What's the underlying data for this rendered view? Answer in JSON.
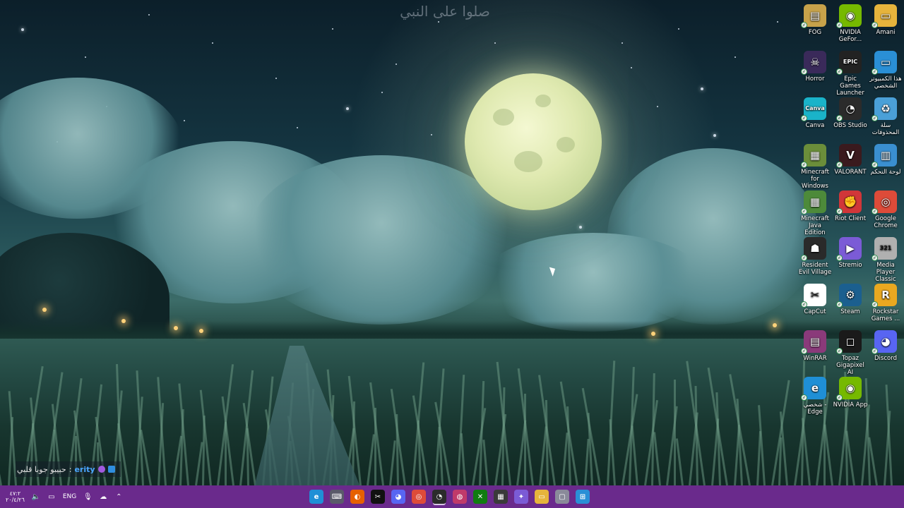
{
  "wallpaper": {
    "watermark_text": "صلوا على النبي",
    "moon_color": "#e6eeb8",
    "sky_color": "#143440"
  },
  "chat_overlay": {
    "username": "erity",
    "separator": ":",
    "message": "حبيبو جوبا قلبي"
  },
  "desktop": {
    "icons": [
      {
        "label": "FOG",
        "icon": "folder-icon",
        "color": "#c7a24a",
        "glyph": "▤"
      },
      {
        "label": "NVIDIA GeFor...",
        "icon": "nvidia-icon",
        "color": "#76b900",
        "glyph": "◉"
      },
      {
        "label": "Amani",
        "icon": "folder-icon",
        "color": "#e6b43c",
        "glyph": "▭"
      },
      {
        "label": "Horror",
        "icon": "ghost-icon",
        "color": "#3a2a5a",
        "glyph": "☠"
      },
      {
        "label": "Epic Games Launcher",
        "icon": "epic-games-icon",
        "color": "#222222",
        "glyph": "EPIC"
      },
      {
        "label": "هذا الكمبيوتر الشخصي",
        "icon": "computer-icon",
        "color": "#2a8fd6",
        "glyph": "▭"
      },
      {
        "label": "Canva",
        "icon": "canva-icon",
        "color": "#1ab3c9",
        "glyph": "Canva"
      },
      {
        "label": "OBS Studio",
        "icon": "obs-icon",
        "color": "#2b2b2b",
        "glyph": "◔"
      },
      {
        "label": "سلة المحذوفات",
        "icon": "recycle-bin-icon",
        "color": "#4aa0d8",
        "glyph": "♻"
      },
      {
        "label": "Minecraft for Windows",
        "icon": "minecraft-icon",
        "color": "#6b8e3a",
        "glyph": "▦"
      },
      {
        "label": "VALORANT",
        "icon": "valorant-icon",
        "color": "#3a1a1e",
        "glyph": "V"
      },
      {
        "label": "لوحة التحكم",
        "icon": "control-panel-icon",
        "color": "#3a8fd0",
        "glyph": "▥"
      },
      {
        "label": "Minecraft Java Edition",
        "icon": "minecraft-java-icon",
        "color": "#4d8a3a",
        "glyph": "▦"
      },
      {
        "label": "Riot Client",
        "icon": "riot-icon",
        "color": "#d13639",
        "glyph": "✊"
      },
      {
        "label": "Google Chrome",
        "icon": "chrome-icon",
        "color": "#dd4b39",
        "glyph": "◎"
      },
      {
        "label": "Resident Evil Village",
        "icon": "resident-evil-icon",
        "color": "#2a2a2a",
        "glyph": "☗"
      },
      {
        "label": "Stremio",
        "icon": "stremio-icon",
        "color": "#7b5bd6",
        "glyph": "▶"
      },
      {
        "label": "Media Player Classic",
        "icon": "media-player-icon",
        "color": "#b0b0b0",
        "glyph": "321"
      },
      {
        "label": "CapCut",
        "icon": "capcut-icon",
        "color": "#ffffff",
        "glyph": "✂"
      },
      {
        "label": "Steam",
        "icon": "steam-icon",
        "color": "#1b5f8f",
        "glyph": "⚙"
      },
      {
        "label": "Rockstar Games ...",
        "icon": "rockstar-icon",
        "color": "#e9a820",
        "glyph": "R"
      },
      {
        "label": "WinRAR",
        "icon": "winrar-icon",
        "color": "#8a3a7a",
        "glyph": "▤"
      },
      {
        "label": "Topaz Gigapixel AI",
        "icon": "topaz-icon",
        "color": "#1a1a1a",
        "glyph": "◻"
      },
      {
        "label": "Discord",
        "icon": "discord-icon",
        "color": "#5865f2",
        "glyph": "◕"
      },
      {
        "label": "شخصي - Edge",
        "icon": "edge-icon",
        "color": "#1f8fd6",
        "glyph": "e"
      },
      {
        "label": "NVIDIA App",
        "icon": "nvidia-app-icon",
        "color": "#76b900",
        "glyph": "◉"
      }
    ]
  },
  "taskbar": {
    "color": "#6a2a8c",
    "tray": {
      "clock_time": "٤٧:٢",
      "clock_date": "٢٠/٤/٢٦",
      "language": "ENG"
    },
    "apps": [
      {
        "name": "edge-taskbar-icon",
        "color": "#1f8fd6",
        "glyph": "e"
      },
      {
        "name": "keyboard-taskbar-icon",
        "color": "#5a5a6a",
        "glyph": "⌨"
      },
      {
        "name": "firefox-taskbar-icon",
        "color": "#e66000",
        "glyph": "◐"
      },
      {
        "name": "capcut-taskbar-icon",
        "color": "#111111",
        "glyph": "✂"
      },
      {
        "name": "discord-taskbar-icon",
        "color": "#5865f2",
        "glyph": "◕"
      },
      {
        "name": "chrome-taskbar-icon",
        "color": "#dd4b39",
        "glyph": "◎"
      },
      {
        "name": "obs-taskbar-icon",
        "color": "#2b2b2b",
        "glyph": "◔"
      },
      {
        "name": "color-app-taskbar-icon",
        "color": "#c03a6a",
        "glyph": "◍"
      },
      {
        "name": "xbox-taskbar-icon",
        "color": "#107c10",
        "glyph": "✕"
      },
      {
        "name": "clapper-taskbar-icon",
        "color": "#3a3a3a",
        "glyph": "▦"
      },
      {
        "name": "copilot-taskbar-icon",
        "color": "#7b5bd6",
        "glyph": "✦"
      },
      {
        "name": "file-explorer-taskbar-icon",
        "color": "#e6b43c",
        "glyph": "▭"
      },
      {
        "name": "window-taskbar-icon",
        "color": "#8a8a9a",
        "glyph": "▢"
      },
      {
        "name": "start-taskbar-icon",
        "color": "#2a8fd6",
        "glyph": "⊞"
      }
    ]
  }
}
